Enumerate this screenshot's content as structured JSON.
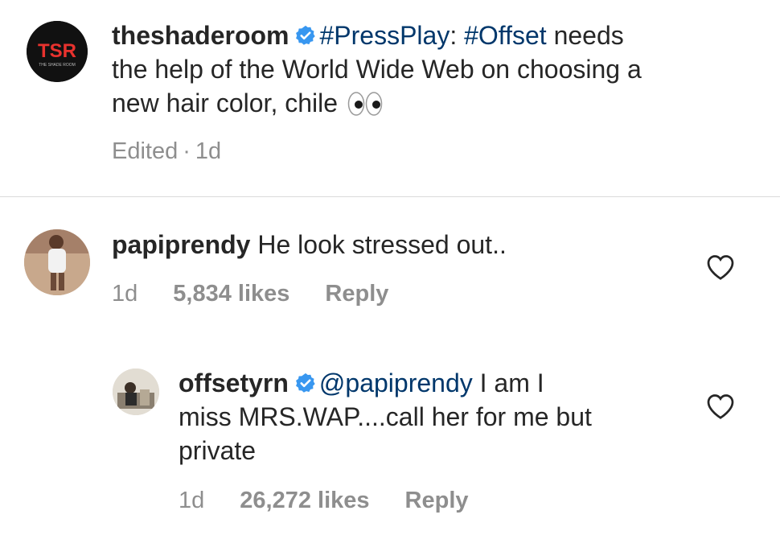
{
  "caption": {
    "username": "theshaderoom",
    "logo_text": "TSR",
    "logo_subtext": "THE SHADE ROOM",
    "text_parts": [
      "#PressPlay",
      ": ",
      "#Offset",
      " needs"
    ],
    "line2": "the help of the World Wide Web on choosing a",
    "line3": "new hair color, chile",
    "emoji": "eyes",
    "edited": "Edited",
    "separator": "·",
    "time": "1d"
  },
  "comments": [
    {
      "username": "papiprendy",
      "text": "He look stressed out..",
      "time": "1d",
      "likes": "5,834 likes",
      "reply_label": "Reply",
      "verified": false
    },
    {
      "username": "offsetyrn",
      "mention": "@papiprendy",
      "text_line1": " I am I",
      "text_line2": "miss MRS.WAP....call her for me but",
      "text_line3": "private",
      "time": "1d",
      "likes": "26,272 likes",
      "reply_label": "Reply",
      "verified": true
    }
  ],
  "colors": {
    "verified": "#3897f0",
    "link": "#00376b",
    "meta": "#8e8e8e",
    "logo_red": "#e8322e"
  },
  "icons": [
    "verified-badge-icon",
    "heart-icon",
    "eyes-emoji"
  ]
}
